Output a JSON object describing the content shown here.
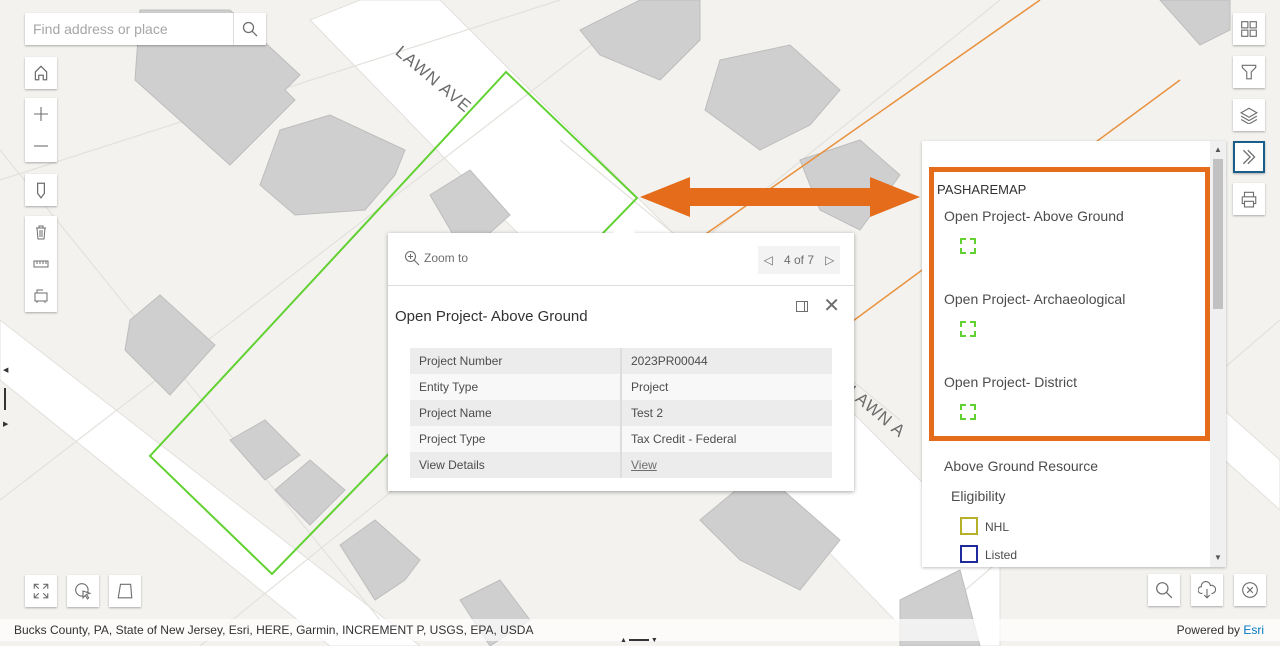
{
  "search": {
    "placeholder": "Find address or place"
  },
  "map": {
    "street_labels": [
      "LAWN AVE",
      "LAWN A"
    ],
    "colors": {
      "parcel_outline": "#62d132",
      "annotation": "#e46c1a",
      "building": "#cfcfcf",
      "road": "#ffffff",
      "ground": "#f3f2ef",
      "highlight_button": "#1a5e8a"
    }
  },
  "left_toolbar": {
    "buttons": [
      {
        "name": "home",
        "icon": "home-icon"
      },
      {
        "name": "zoom-in",
        "icon": "plus-icon"
      },
      {
        "name": "zoom-out",
        "icon": "minus-icon"
      },
      {
        "name": "locate",
        "icon": "location-pin-icon"
      },
      {
        "name": "clear",
        "icon": "trash-icon"
      },
      {
        "name": "measure",
        "icon": "ruler-icon"
      },
      {
        "name": "print-area",
        "icon": "select-icon"
      }
    ]
  },
  "right_toolbar": {
    "buttons": [
      {
        "name": "basemap-gallery",
        "icon": "grid-icon"
      },
      {
        "name": "filter",
        "icon": "filter-icon"
      },
      {
        "name": "layer-list",
        "icon": "layers-icon"
      },
      {
        "name": "legend",
        "icon": "double-chevron-icon",
        "active": true
      },
      {
        "name": "print",
        "icon": "printer-icon"
      }
    ]
  },
  "bottom_left_toolbar": [
    "fullscreen",
    "select-by-click",
    "draw-polygon"
  ],
  "bottom_right_toolbar": [
    "search",
    "download",
    "close"
  ],
  "popup": {
    "zoom_to_label": "Zoom to",
    "pager": "4 of 7",
    "title": "Open Project- Above Ground",
    "rows": [
      {
        "field": "Project Number",
        "value": "2023PR00044"
      },
      {
        "field": "Entity Type",
        "value": "Project"
      },
      {
        "field": "Project Name",
        "value": "Test 2"
      },
      {
        "field": "Project Type",
        "value": "Tax Credit - Federal"
      },
      {
        "field": "View Details",
        "value": "View",
        "link": true
      }
    ]
  },
  "legend": {
    "service": "PASHAREMAP",
    "layers": [
      {
        "label": "Open Project- Above Ground",
        "swatch": "#62d132"
      },
      {
        "label": "Open Project- Archaeological",
        "swatch": "#62d132"
      },
      {
        "label": "Open Project- District",
        "swatch": "#62d132"
      }
    ],
    "group": "Above Ground Resource",
    "subgroup": "Eligibility",
    "items": [
      {
        "label": "NHL",
        "color": "#b5b02a"
      },
      {
        "label": "Listed",
        "color": "#1f2a9c"
      }
    ]
  },
  "attribution": {
    "sources": "Bucks County, PA, State of New Jersey, Esri, HERE, Garmin, INCREMENT P, USGS, EPA, USDA",
    "powered_by": "Powered by ",
    "esri": "Esri"
  }
}
